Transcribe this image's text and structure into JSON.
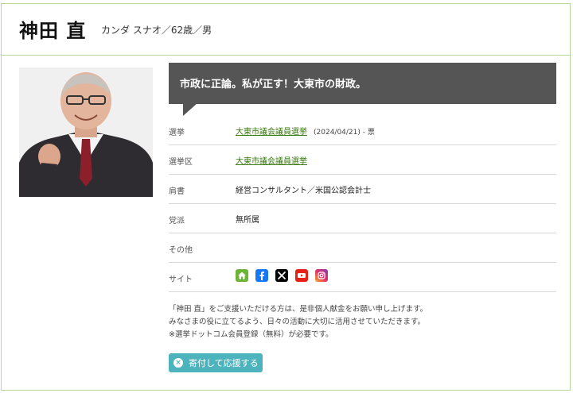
{
  "profile": {
    "name": "神田 直",
    "subtitle": "カンダ スナオ／62歳／男"
  },
  "banner": {
    "text": "市政に正論。私が正す！大東市の財政。"
  },
  "rows": {
    "election": {
      "label": "選挙",
      "link": "大東市議会議員選挙",
      "note": "(2024/04/21) - 票"
    },
    "district": {
      "label": "選挙区",
      "link": "大東市議会議員選挙"
    },
    "title": {
      "label": "肩書",
      "value": "経営コンサルタント／米国公認会計士"
    },
    "party": {
      "label": "党派",
      "value": "無所属"
    },
    "other": {
      "label": "その他",
      "value": ""
    },
    "site": {
      "label": "サイト",
      "icons": [
        "home-icon",
        "facebook-icon",
        "x-icon",
        "youtube-icon",
        "instagram-icon"
      ]
    }
  },
  "note": {
    "line1": "「神田 直」をご支援いただける方は、是非個人献金をお願い申し上げます。",
    "line2": "みなさまの役に立てるよう、日々の活動に大切に活用させていただきます。",
    "line3": "※選挙ドットコム会員登録（無料）が必要です。"
  },
  "donate": {
    "label": "寄付して応援する"
  },
  "colors": {
    "frame_border": "#b7d89a",
    "banner_bg": "#555555",
    "link": "#3a7a10",
    "donate_bg": "#4db4bd"
  }
}
